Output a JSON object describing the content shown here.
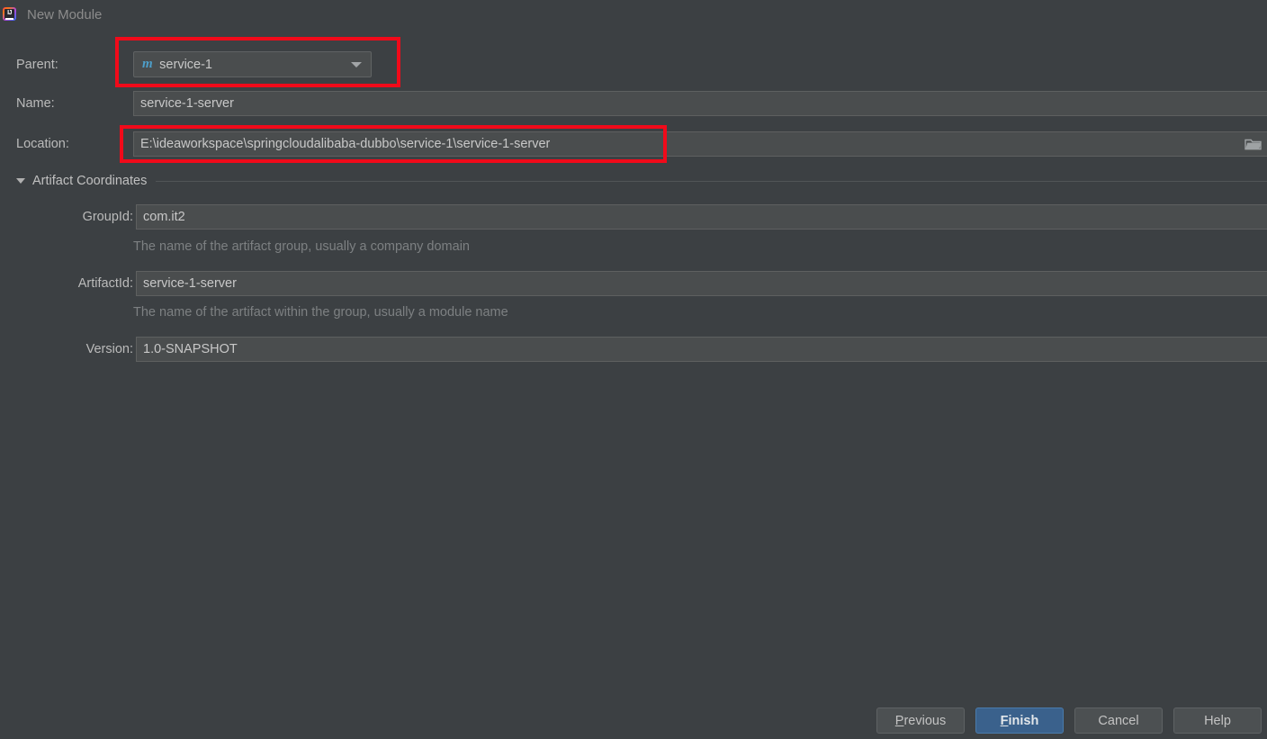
{
  "window": {
    "title": "New Module",
    "icon": "intellij-idea-icon",
    "background_color": "#3c4043"
  },
  "form": {
    "parent": {
      "label": "Parent:",
      "value": "service-1",
      "icon": "maven-module-icon",
      "icon_glyph": "m",
      "icon_color": "#4d9ec9",
      "dropdown_icon": "chevron-down-icon"
    },
    "name": {
      "label": "Name:",
      "value": "service-1-server"
    },
    "location": {
      "label": "Location:",
      "value": "E:\\ideaworkspace\\springcloudalibaba-dubbo\\service-1\\service-1-server",
      "browse_icon": "folder-icon"
    }
  },
  "artifact_coordinates": {
    "section_title": "Artifact Coordinates",
    "expanded": true,
    "toggle_icon": "triangle-down-icon",
    "group_id": {
      "label": "GroupId:",
      "value": "com.it2",
      "hint": "The name of the artifact group, usually a company domain"
    },
    "artifact_id": {
      "label": "ArtifactId:",
      "value": "service-1-server",
      "hint": "The name of the artifact within the group, usually a module name"
    },
    "version": {
      "label": "Version:",
      "value": "1.0-SNAPSHOT"
    }
  },
  "annotations": {
    "color": "#f10a1a",
    "boxes": [
      "parent-field-highlight",
      "location-field-highlight"
    ]
  },
  "footer": {
    "previous": {
      "mnemonic": "P",
      "rest": "revious"
    },
    "finish": {
      "mnemonic": "F",
      "rest": "inish",
      "accent_color": "#3a618c"
    },
    "cancel": "Cancel",
    "help": "Help"
  }
}
